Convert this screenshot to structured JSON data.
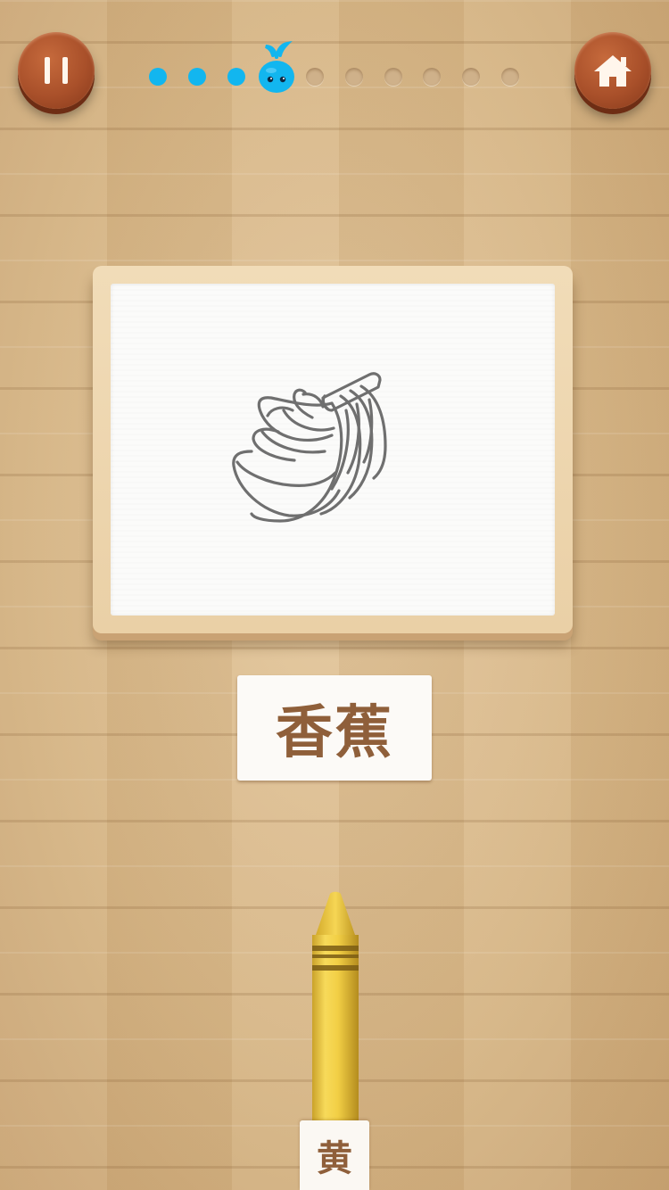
{
  "header": {
    "pause_icon": "pause-icon",
    "home_icon": "home-icon",
    "progress": {
      "total": 10,
      "current": 4,
      "done_color": "#12b6ef",
      "todo_color": "#cfb18a",
      "marker_icon": "whale-icon"
    }
  },
  "picture": {
    "icon": "banana-bunch-outline",
    "line_color": "#6f6f6f"
  },
  "word_card": {
    "text": "香蕉"
  },
  "crayon": {
    "color_name": "黄",
    "color": "#f2cf45"
  }
}
